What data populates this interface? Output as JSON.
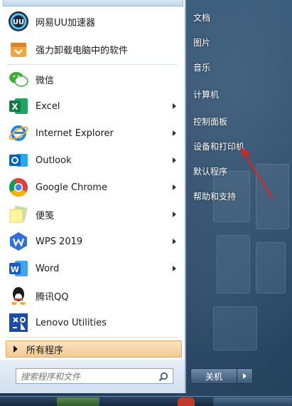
{
  "start_menu": {
    "pinned": [
      {
        "label": "网易UU加速器",
        "icon": "uu-accelerator-icon"
      },
      {
        "label": "强力卸载电脑中的软件",
        "icon": "uninstaller-icon"
      }
    ],
    "recent": [
      {
        "label": "微信",
        "icon": "wechat-icon",
        "has_submenu": false
      },
      {
        "label": "Excel",
        "icon": "excel-icon",
        "has_submenu": true
      },
      {
        "label": "Internet Explorer",
        "icon": "internet-explorer-icon",
        "has_submenu": true
      },
      {
        "label": "Outlook",
        "icon": "outlook-icon",
        "has_submenu": true
      },
      {
        "label": "Google Chrome",
        "icon": "chrome-icon",
        "has_submenu": true
      },
      {
        "label": "便笺",
        "icon": "sticky-notes-icon",
        "has_submenu": true
      },
      {
        "label": "WPS 2019",
        "icon": "wps-icon",
        "has_submenu": true
      },
      {
        "label": "Word",
        "icon": "word-icon",
        "has_submenu": true
      },
      {
        "label": "腾讯QQ",
        "icon": "qq-icon",
        "has_submenu": false
      },
      {
        "label": "Lenovo Utilities",
        "icon": "lenovo-utilities-icon",
        "has_submenu": false
      }
    ],
    "all_programs": "所有程序",
    "search_placeholder": "搜索程序和文件",
    "right_links": [
      "文档",
      "图片",
      "音乐",
      "计算机",
      "控制面板",
      "设备和打印机",
      "默认程序",
      "帮助和支持"
    ],
    "shutdown_label": "关机"
  },
  "colors": {
    "all_programs_bg": "#f5c98c",
    "annotation_arrow": "#e02020",
    "panel_bg": "#ffffff"
  }
}
